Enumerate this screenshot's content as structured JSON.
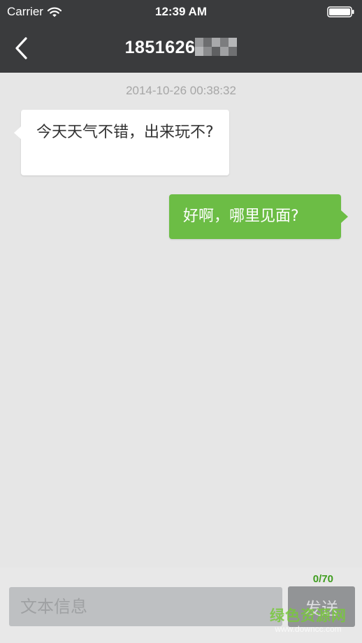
{
  "status_bar": {
    "carrier": "Carrier",
    "time": "12:39 AM",
    "icons": [
      "wifi-icon",
      "battery-icon"
    ]
  },
  "nav": {
    "back_icon": "chevron-left-icon",
    "title": "1851626"
  },
  "conversation": {
    "timestamp": "2014-10-26 00:38:32",
    "messages": [
      {
        "direction": "incoming",
        "text": "今天天气不错，出来玩不?"
      },
      {
        "direction": "outgoing",
        "text": "好啊，哪里见面?"
      }
    ]
  },
  "composer": {
    "char_count": "0/70",
    "placeholder": "文本信息",
    "value": "",
    "send_label": "发送"
  },
  "watermark": {
    "main": "绿色资源网",
    "sub": "www.downcc.com"
  },
  "colors": {
    "bar_background": "#3a3b3d",
    "chat_background": "#e6e6e6",
    "outgoing_bubble": "#6cbd45",
    "incoming_bubble": "#ffffff",
    "counter_text": "#3f9d1f",
    "send_button_disabled": "#929496"
  }
}
